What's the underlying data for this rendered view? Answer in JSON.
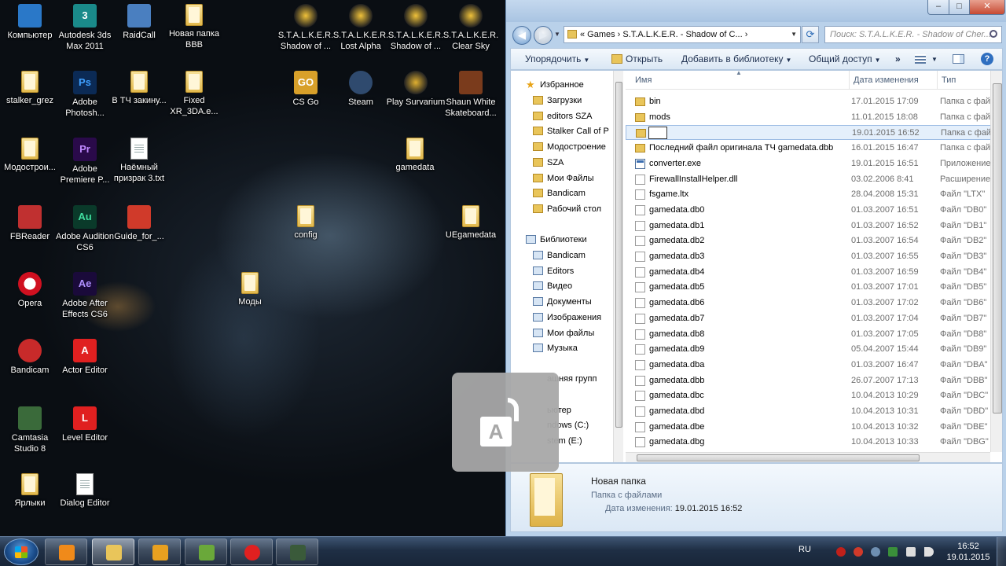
{
  "desktop": {
    "icons": [
      {
        "label": "Компьютер",
        "icon": "computer-icon"
      },
      {
        "label": "Autodesk 3ds Max 2011",
        "icon": "3ds-max-icon"
      },
      {
        "label": "RaidCall",
        "icon": "raidcall-icon"
      },
      {
        "label": "Новая папка BBB",
        "icon": "folder-icon"
      },
      {
        "label": "S.T.A.L.K.E.R. Shadow of ...",
        "icon": "stalker-icon"
      },
      {
        "label": "S.T.A.L.K.E.R. Lost Alpha",
        "icon": "stalker-icon"
      },
      {
        "label": "S.T.A.L.K.E.R. Shadow of ...",
        "icon": "stalker-icon"
      },
      {
        "label": "S.T.A.L.K.E.R. Clear Sky",
        "icon": "stalker-icon"
      },
      {
        "label": "stalker_grez",
        "icon": "folder-icon"
      },
      {
        "label": "Adobe Photosh...",
        "icon": "photoshop-icon"
      },
      {
        "label": "В ТЧ закину...",
        "icon": "folder-icon"
      },
      {
        "label": "Fixed XR_3DA.e...",
        "icon": "folder-icon"
      },
      {
        "label": "CS Go",
        "icon": "csgo-icon"
      },
      {
        "label": "Steam",
        "icon": "steam-icon"
      },
      {
        "label": "Play Survarium",
        "icon": "survarium-icon"
      },
      {
        "label": "Shaun White Skateboard...",
        "icon": "game-icon"
      },
      {
        "label": "Модострои...",
        "icon": "folder-icon"
      },
      {
        "label": "Adobe Premiere P...",
        "icon": "premiere-icon"
      },
      {
        "label": "Наёмный призрак 3.txt",
        "icon": "text-file-icon"
      },
      {
        "label": "gamedata",
        "icon": "folder-icon"
      },
      {
        "label": "FBReader",
        "icon": "fbreader-icon"
      },
      {
        "label": "Adobe Audition CS6",
        "icon": "audition-icon"
      },
      {
        "label": "Guide_for_...",
        "icon": "pdf-icon"
      },
      {
        "label": "config",
        "icon": "folder-icon"
      },
      {
        "label": "UEgamedata",
        "icon": "folder-icon"
      },
      {
        "label": "Opera",
        "icon": "opera-icon"
      },
      {
        "label": "Adobe After Effects CS6",
        "icon": "after-effects-icon"
      },
      {
        "label": "Моды",
        "icon": "folder-icon"
      },
      {
        "label": "Bandicam",
        "icon": "bandicam-icon"
      },
      {
        "label": "Actor Editor",
        "icon": "actor-editor-icon"
      },
      {
        "label": "Camtasia Studio 8",
        "icon": "camtasia-icon"
      },
      {
        "label": "Level Editor",
        "icon": "level-editor-icon"
      },
      {
        "label": "Ярлыки",
        "icon": "folder-icon"
      },
      {
        "label": "Dialog Editor",
        "icon": "dialog-editor-icon"
      }
    ]
  },
  "explorer": {
    "caption_buttons": {
      "minimize": "–",
      "maximize": "□",
      "close": "✕"
    },
    "nav": {
      "back": "◀",
      "forward": "▶"
    },
    "address": "« Games › S.T.A.L.K.E.R. - Shadow of C... ›",
    "search_placeholder": "Поиск: S.T.A.L.K.E.R. - Shadow of Cher...",
    "commands": {
      "organize": "Упорядочить",
      "open": "Открыть",
      "add_to_library": "Добавить в библиотеку",
      "share": "Общий доступ",
      "more": "»"
    },
    "navpane": {
      "favorites_header": "Избранное",
      "favorites": [
        "Загрузки",
        "editors SZA",
        "Stalker Call of P",
        "Модостроение",
        "SZA",
        "Мои Файлы",
        "Bandicam",
        "Рабочий стол"
      ],
      "libraries_header": "Библиотеки",
      "libraries": [
        "Bandicam",
        "Editors",
        "Видео",
        "Документы",
        "Изображения",
        "Мои файлы",
        "Музыка"
      ],
      "homegroup": "ашняя групп",
      "computer": "ьютер",
      "drives": [
        "ndows (C:)",
        "stem (E:)"
      ]
    },
    "columns": {
      "name": "Имя",
      "date": "Дата изменения",
      "type": "Тип"
    },
    "files": [
      {
        "name": "bin",
        "date": "17.01.2015 17:09",
        "type": "Папка с фай",
        "kind": "folder"
      },
      {
        "name": "mods",
        "date": "11.01.2015 18:08",
        "type": "Папка с фай",
        "kind": "folder"
      },
      {
        "name": "",
        "date": "19.01.2015 16:52",
        "type": "Папка с фай",
        "kind": "folder",
        "renaming": true
      },
      {
        "name": "Последний файл оригинала ТЧ gamedata.dbb",
        "date": "16.01.2015 16:47",
        "type": "Папка с фай",
        "kind": "folder"
      },
      {
        "name": "converter.exe",
        "date": "19.01.2015 16:51",
        "type": "Приложение",
        "kind": "exe"
      },
      {
        "name": "FirewallInstallHelper.dll",
        "date": "03.02.2006 8:41",
        "type": "Расширение",
        "kind": "file"
      },
      {
        "name": "fsgame.ltx",
        "date": "28.04.2008 15:31",
        "type": "Файл \"LTX\"",
        "kind": "file"
      },
      {
        "name": "gamedata.db0",
        "date": "01.03.2007 16:51",
        "type": "Файл \"DB0\"",
        "kind": "file"
      },
      {
        "name": "gamedata.db1",
        "date": "01.03.2007 16:52",
        "type": "Файл \"DB1\"",
        "kind": "file"
      },
      {
        "name": "gamedata.db2",
        "date": "01.03.2007 16:54",
        "type": "Файл \"DB2\"",
        "kind": "file"
      },
      {
        "name": "gamedata.db3",
        "date": "01.03.2007 16:55",
        "type": "Файл \"DB3\"",
        "kind": "file"
      },
      {
        "name": "gamedata.db4",
        "date": "01.03.2007 16:59",
        "type": "Файл \"DB4\"",
        "kind": "file"
      },
      {
        "name": "gamedata.db5",
        "date": "01.03.2007 17:01",
        "type": "Файл \"DB5\"",
        "kind": "file"
      },
      {
        "name": "gamedata.db6",
        "date": "01.03.2007 17:02",
        "type": "Файл \"DB6\"",
        "kind": "file"
      },
      {
        "name": "gamedata.db7",
        "date": "01.03.2007 17:04",
        "type": "Файл \"DB7\"",
        "kind": "file"
      },
      {
        "name": "gamedata.db8",
        "date": "01.03.2007 17:05",
        "type": "Файл \"DB8\"",
        "kind": "file"
      },
      {
        "name": "gamedata.db9",
        "date": "05.04.2007 15:44",
        "type": "Файл \"DB9\"",
        "kind": "file"
      },
      {
        "name": "gamedata.dba",
        "date": "01.03.2007 16:47",
        "type": "Файл \"DBA\"",
        "kind": "file"
      },
      {
        "name": "gamedata.dbb",
        "date": "26.07.2007 17:13",
        "type": "Файл \"DBB\"",
        "kind": "file"
      },
      {
        "name": "gamedata.dbc",
        "date": "10.04.2013 10:29",
        "type": "Файл \"DBC\"",
        "kind": "file"
      },
      {
        "name": "gamedata.dbd",
        "date": "10.04.2013 10:31",
        "type": "Файл \"DBD\"",
        "kind": "file"
      },
      {
        "name": "gamedata.dbe",
        "date": "10.04.2013 10:32",
        "type": "Файл \"DBE\"",
        "kind": "file"
      },
      {
        "name": "gamedata.dbg",
        "date": "10.04.2013 10:33",
        "type": "Файл \"DBG\"",
        "kind": "file"
      }
    ],
    "details": {
      "name": "Новая папка",
      "type": "Папка с файлами",
      "date_label": "Дата изменения:",
      "date_value": "19.01.2015 16:52"
    }
  },
  "overlay": {
    "capslock_letter": "A"
  },
  "taskbar": {
    "apps": [
      "media-player-icon",
      "explorer-icon",
      "hamachi-icon",
      "notepad-plus-icon",
      "yandex-browser-icon",
      "terminal-icon"
    ],
    "lang": "RU",
    "time": "16:52",
    "date": "19.01.2015"
  }
}
